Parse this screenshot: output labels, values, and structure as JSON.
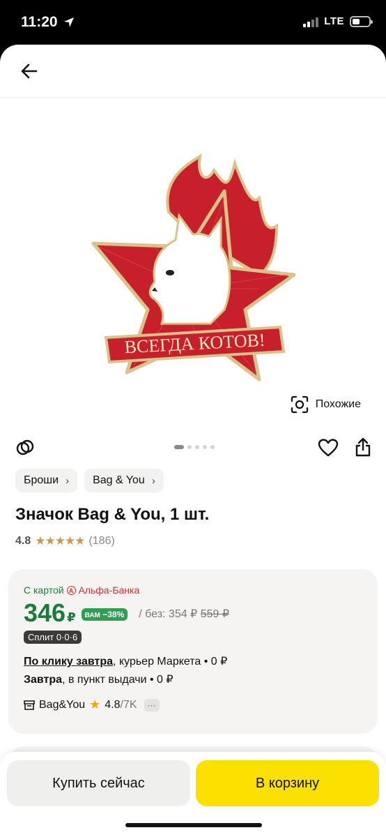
{
  "status": {
    "time": "11:20",
    "network": "LTE"
  },
  "icons": {
    "back": "arrow-left-icon",
    "similar": "visual-search-icon",
    "compare": "compare-icon",
    "favorite": "heart-icon",
    "share": "share-icon",
    "shop": "store-icon"
  },
  "colors": {
    "price_green": "#1e7a3c",
    "cart_yellow": "#fbe000",
    "discount_green": "#2f9e55",
    "star_gold": "#c79a52"
  },
  "image": {
    "banner_text": "ВСЕГДА КОТОВ!",
    "dots_total": 5,
    "dot_active": 1
  },
  "similar_label": "Похожие",
  "breadcrumbs": [
    {
      "label": "Броши"
    },
    {
      "label": "Bag & You"
    }
  ],
  "product": {
    "title": "Значок Bag & You, 1 шт.",
    "rating": "4.8",
    "stars": "★★★★★",
    "reviews": "(186)"
  },
  "offer": {
    "card_prefix": "С картой",
    "bank_logo": "А",
    "bank_name": "Альфа-Банка",
    "price": "346",
    "currency": "₽",
    "discount_vam": "ВАМ",
    "discount_pct": "−38%",
    "without_label": "/ без: 354 ₽",
    "old_price": "559 ₽",
    "split": "Сплит 0·0·6",
    "delivery_1_link": "По клику завтра",
    "delivery_1_rest": ", курьер Маркета • 0 ₽",
    "delivery_2_bold": "Завтра",
    "delivery_2_rest": ", в пункт выдачи • 0 ₽",
    "seller_name": "Bag&You",
    "seller_rating": "4.8",
    "seller_count": "/7K",
    "more": "···"
  },
  "actions": {
    "buy_now": "Купить сейчас",
    "add_to_cart": "В корзину"
  }
}
